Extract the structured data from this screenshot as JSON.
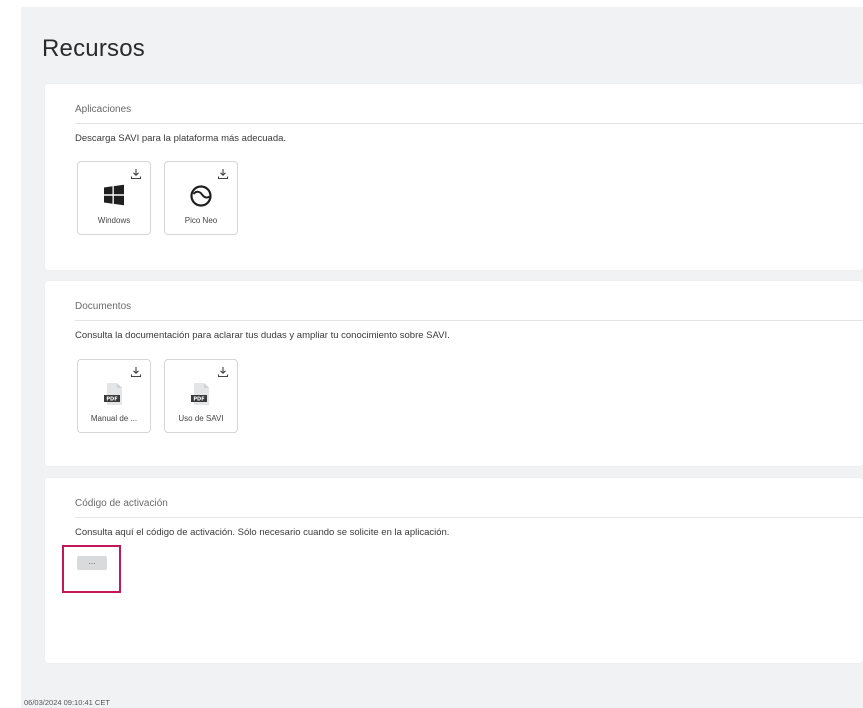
{
  "page": {
    "title": "Recursos"
  },
  "sections": {
    "apps": {
      "heading": "Aplicaciones",
      "description": "Descarga SAVI para la plataforma más adecuada.",
      "tiles": [
        {
          "label": "Windows",
          "icon": "windows-icon"
        },
        {
          "label": "Pico Neo",
          "icon": "pico-neo-icon"
        }
      ]
    },
    "docs": {
      "heading": "Documentos",
      "description": "Consulta la documentación para aclarar tus dudas y ampliar tu conocimiento sobre SAVI.",
      "tiles": [
        {
          "label": "Manual de ...",
          "icon": "pdf-icon"
        },
        {
          "label": "Uso de SAVI",
          "icon": "pdf-icon"
        }
      ]
    },
    "activation": {
      "heading": "Código de activación",
      "description": "Consulta aquí el código de activación. Sólo necesario cuando se solicite en la aplicación.",
      "button_label": "..."
    }
  },
  "footer": {
    "timestamp": "06/03/2024 09:10:41 CET"
  },
  "colors": {
    "highlight": "#c2185b",
    "background": "#f1f2f4"
  }
}
